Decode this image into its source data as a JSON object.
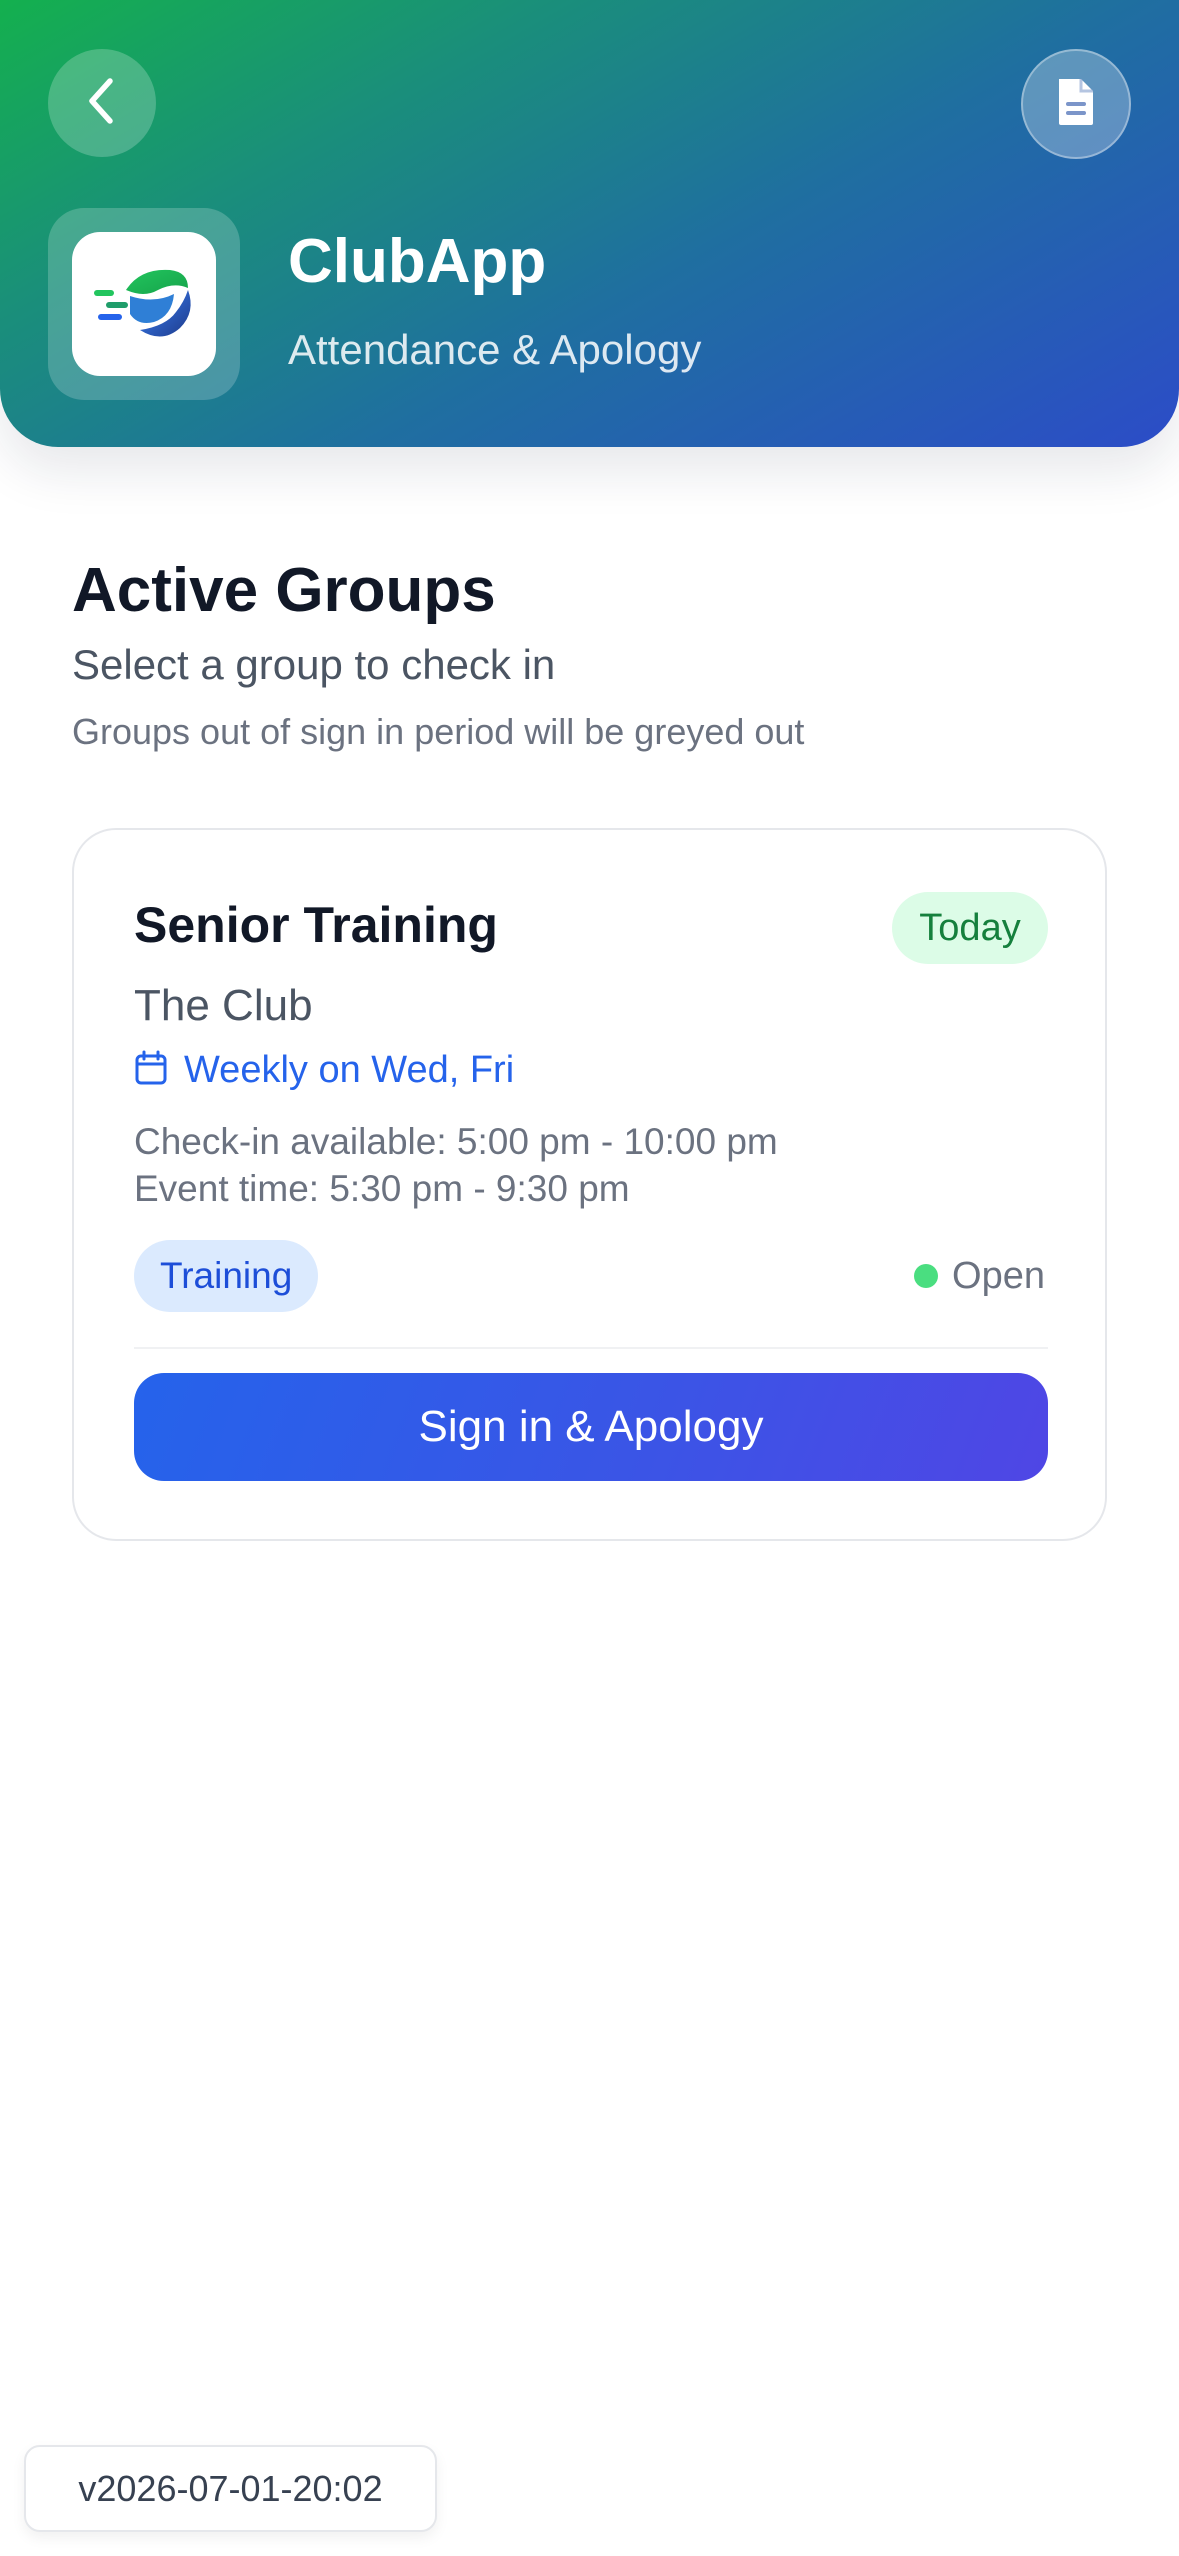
{
  "header": {
    "app_name": "ClubApp",
    "app_subtitle": "Attendance & Apology",
    "back_icon": "chevron-left-icon",
    "document_icon": "document-icon",
    "logo_icon": "clubapp-logo-icon",
    "gradient_colors": [
      "#14b04e",
      "#1f6fa0",
      "#2c4cc8"
    ]
  },
  "section": {
    "title": "Active Groups",
    "subtitle": "Select a group to check in",
    "hint": "Groups out of sign in period will be greyed out"
  },
  "groups": [
    {
      "name": "Senior Training",
      "badge": "Today",
      "venue": "The Club",
      "schedule_icon": "calendar-icon",
      "schedule": "Weekly on Wed, Fri",
      "checkin_window": "Check-in available: 5:00 pm - 10:00 pm",
      "event_time": "Event time: 5:30 pm - 9:30 pm",
      "tag": "Training",
      "status": "Open",
      "status_color": "#4ade80",
      "action_label": "Sign in & Apology"
    }
  ],
  "footer": {
    "version": "v2026-07-01-20:02"
  },
  "colors": {
    "accent_blue": "#2563eb",
    "success_green": "#15803d",
    "text_dark": "#111827"
  }
}
